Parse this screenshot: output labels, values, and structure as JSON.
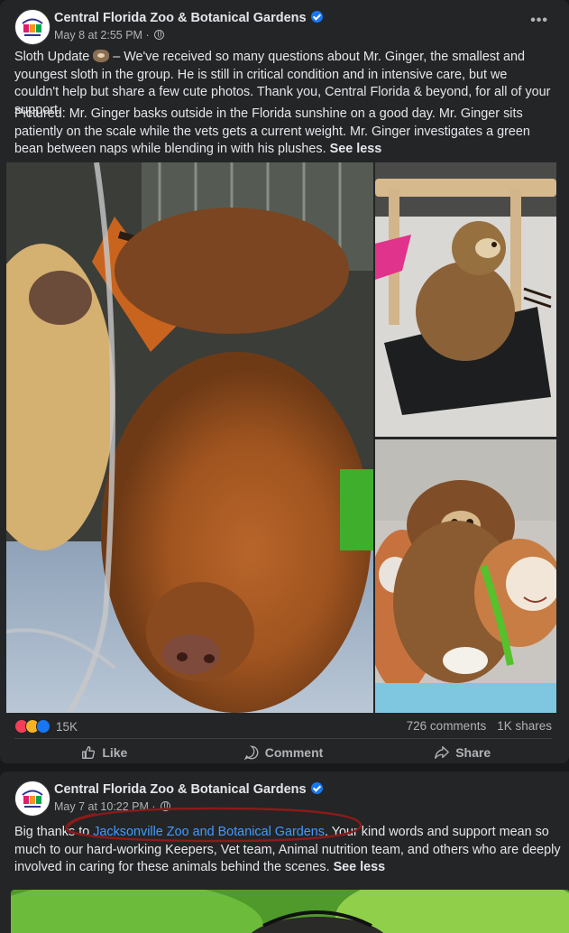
{
  "post1": {
    "page_name": "Central Florida Zoo & Botanical Gardens",
    "date": "May 8 at 2:55 PM",
    "separator": "·",
    "more_icon": "more-options-icon",
    "verified_icon": "verified-badge-icon",
    "text_para1_pre": "Sloth Update ",
    "text_para1_post": " – We've received so many questions about Mr. Ginger, the smallest and youngest sloth in the group. He is still in critical condition and in intensive care, but we couldn't help but share a few cute photos. Thank you, Central Florida & beyond, for all of your support.",
    "text_para2": "Pictured: Mr. Ginger basks outside in the Florida sunshine on a good day. Mr. Ginger sits patiently on the scale while the vets gets a current weight. Mr. Ginger investigates a green bean between naps while blending in with his plushes.",
    "see_less": "See less",
    "reaction_count": "15K",
    "comments": "726 comments",
    "shares": "1K shares",
    "actions": {
      "like": "Like",
      "comment": "Comment",
      "share": "Share"
    }
  },
  "post2": {
    "page_name": "Central Florida Zoo & Botanical Gardens",
    "date": "May 7 at 10:22 PM",
    "separator": "·",
    "text_pre": "Big thanks to ",
    "link_text": "Jacksonville Zoo and Botanical Gardens",
    "text_post": ". Your kind words and support mean so much to our hard-working Keepers, Vet team, Animal nutrition team, and others who are deeply involved in caring for these animals behind the scenes.",
    "see_less": "See less"
  },
  "colors": {
    "background": "#18191a",
    "card": "#242526",
    "text_primary": "#e4e6eb",
    "text_secondary": "#b0b3b8",
    "link": "#4599ff",
    "verified": "#1877f2",
    "annotation": "#8b1a1a"
  }
}
